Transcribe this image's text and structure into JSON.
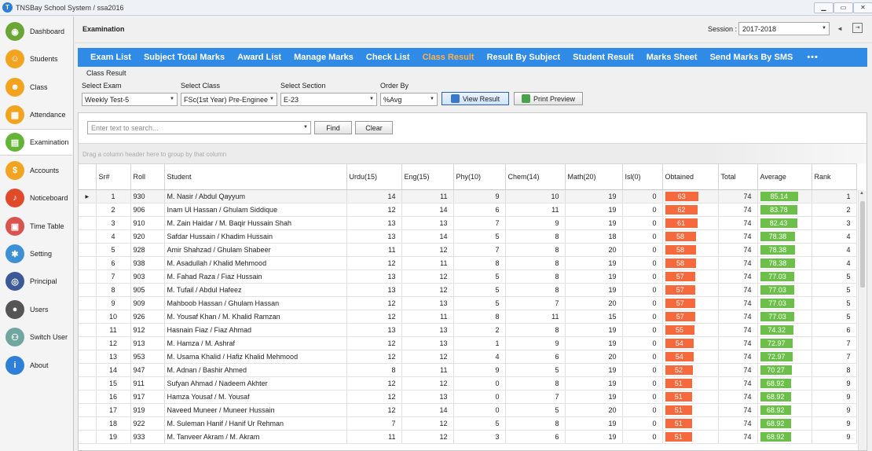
{
  "window": {
    "title": "TNSBay School System / ssa2016",
    "logo_text": "T",
    "min": "▁",
    "max": "▭",
    "close": "✕"
  },
  "sidebar": {
    "items": [
      {
        "label": "Dashboard",
        "icon": "dashboard-icon",
        "glyph": "◉",
        "color": "#6aa636"
      },
      {
        "label": "Students",
        "icon": "student-icon",
        "glyph": "☺",
        "color": "#f2a320"
      },
      {
        "label": "Class",
        "icon": "class-icon",
        "glyph": "☻",
        "color": "#f2a320"
      },
      {
        "label": "Attendance",
        "icon": "attendance-icon",
        "glyph": "▦",
        "color": "#f2a320"
      },
      {
        "label": "Examination",
        "icon": "examination-icon",
        "glyph": "▤",
        "color": "#64b436"
      },
      {
        "label": "Accounts",
        "icon": "accounts-icon",
        "glyph": "$",
        "color": "#f2a320"
      },
      {
        "label": "Noticeboard",
        "icon": "bell-icon",
        "glyph": "♪",
        "color": "#e04a2a"
      },
      {
        "label": "Time Table",
        "icon": "calendar-icon",
        "glyph": "▣",
        "color": "#d9534f"
      },
      {
        "label": "Setting",
        "icon": "gear-icon",
        "glyph": "✱",
        "color": "#3d8fd6"
      },
      {
        "label": "Principal",
        "icon": "eye-icon",
        "glyph": "◎",
        "color": "#3b5998"
      },
      {
        "label": "Users",
        "icon": "user-icon",
        "glyph": "●",
        "color": "#555555"
      },
      {
        "label": "Switch User",
        "icon": "switch-user-icon",
        "glyph": "⚇",
        "color": "#6fa6a0"
      },
      {
        "label": "About",
        "icon": "info-icon",
        "glyph": "i",
        "color": "#2f7fd6"
      }
    ]
  },
  "header": {
    "title": "Examination",
    "session_label": "Session :",
    "session_value": "2017-2018",
    "back_glyph": "◄",
    "exit_glyph": "⇥"
  },
  "tabs": [
    "Exam List",
    "Subject Total Marks",
    "Award List",
    "Manage Marks",
    "Check List",
    "Class Result",
    "Result By Subject",
    "Student Result",
    "Marks Sheet",
    "Send Marks By SMS"
  ],
  "active_tab": "Class Result",
  "tab_more": "•••",
  "filters": {
    "section_title": "Class Result",
    "exam_label": "Select Exam",
    "exam_value": "Weekly Test-5",
    "class_label": "Select Class",
    "class_value": "FSc(1st Year) Pre-Enginee",
    "section_label": "Select Section",
    "section_value": "E-23",
    "order_label": "Order By",
    "order_value": "%Avg",
    "view_button": "View Result",
    "print_button": "Print Preview"
  },
  "grid": {
    "search_placeholder": "Enter text to search...",
    "find_button": "Find",
    "clear_button": "Clear",
    "group_hint": "Drag a column header here to group by that column",
    "columns": [
      "",
      "Sr#",
      "Roll",
      "Student",
      "Urdu(15)",
      "Eng(15)",
      "Phy(10)",
      "Chem(14)",
      "Math(20)",
      "Isl(0)",
      "Obtained",
      "Total",
      "Average",
      "Rank"
    ],
    "current_row_marker": "▶",
    "rows": [
      [
        "1",
        "930",
        "M. Nasir / Abdul Qayyum",
        "14",
        "11",
        "9",
        "10",
        "19",
        "0",
        "63",
        "74",
        "85.14",
        "1"
      ],
      [
        "2",
        "906",
        "Inam Ul Hassan / Ghulam Siddique",
        "12",
        "14",
        "6",
        "11",
        "19",
        "0",
        "62",
        "74",
        "83.78",
        "2"
      ],
      [
        "3",
        "910",
        "M. Zain Haidar / M. Baqir Hussain Shah",
        "13",
        "13",
        "7",
        "9",
        "19",
        "0",
        "61",
        "74",
        "82.43",
        "3"
      ],
      [
        "4",
        "920",
        "Safdar Hussain / Khadim Hussain",
        "13",
        "14",
        "5",
        "8",
        "18",
        "0",
        "58",
        "74",
        "78.38",
        "4"
      ],
      [
        "5",
        "928",
        "Amir Shahzad / Ghulam Shabeer",
        "11",
        "12",
        "7",
        "8",
        "20",
        "0",
        "58",
        "74",
        "78.38",
        "4"
      ],
      [
        "6",
        "938",
        "M. Asadullah / Khalid Mehmood",
        "12",
        "11",
        "8",
        "8",
        "19",
        "0",
        "58",
        "74",
        "78.38",
        "4"
      ],
      [
        "7",
        "903",
        "M. Fahad Raza / Fiaz Hussain",
        "13",
        "12",
        "5",
        "8",
        "19",
        "0",
        "57",
        "74",
        "77.03",
        "5"
      ],
      [
        "8",
        "905",
        "M. Tufail / Abdul Hafeez",
        "13",
        "12",
        "5",
        "8",
        "19",
        "0",
        "57",
        "74",
        "77.03",
        "5"
      ],
      [
        "9",
        "909",
        "Mahboob Hassan / Ghulam Hassan",
        "12",
        "13",
        "5",
        "7",
        "20",
        "0",
        "57",
        "74",
        "77.03",
        "5"
      ],
      [
        "10",
        "926",
        "M. Yousaf Khan / M. Khalid Ramzan",
        "12",
        "11",
        "8",
        "11",
        "15",
        "0",
        "57",
        "74",
        "77.03",
        "5"
      ],
      [
        "11",
        "912",
        "Hasnain Fiaz / Fiaz Ahmad",
        "13",
        "13",
        "2",
        "8",
        "19",
        "0",
        "55",
        "74",
        "74.32",
        "6"
      ],
      [
        "12",
        "913",
        "M. Hamza / M. Ashraf",
        "12",
        "13",
        "1",
        "9",
        "19",
        "0",
        "54",
        "74",
        "72.97",
        "7"
      ],
      [
        "13",
        "953",
        "M. Usama Khalid / Hafiz Khalid Mehmood",
        "12",
        "12",
        "4",
        "6",
        "20",
        "0",
        "54",
        "74",
        "72.97",
        "7"
      ],
      [
        "14",
        "947",
        "M. Adnan / Bashir Ahmed",
        "8",
        "11",
        "9",
        "5",
        "19",
        "0",
        "52",
        "74",
        "70.27",
        "8"
      ],
      [
        "15",
        "911",
        "Sufyan Ahmad / Nadeem Akhter",
        "12",
        "12",
        "0",
        "8",
        "19",
        "0",
        "51",
        "74",
        "68.92",
        "9"
      ],
      [
        "16",
        "917",
        "Hamza Yousaf / M. Yousaf",
        "12",
        "13",
        "0",
        "7",
        "19",
        "0",
        "51",
        "74",
        "68.92",
        "9"
      ],
      [
        "17",
        "919",
        "Naveed Muneer / Muneer Hussain",
        "12",
        "14",
        "0",
        "5",
        "20",
        "0",
        "51",
        "74",
        "68.92",
        "9"
      ],
      [
        "18",
        "922",
        "M. Suleman Hanif / Hanif Ur Rehman",
        "7",
        "12",
        "5",
        "8",
        "19",
        "0",
        "51",
        "74",
        "68.92",
        "9"
      ],
      [
        "19",
        "933",
        "M. Tanveer Akram / M. Akram",
        "11",
        "12",
        "3",
        "6",
        "19",
        "0",
        "51",
        "74",
        "68.92",
        "9"
      ]
    ]
  }
}
